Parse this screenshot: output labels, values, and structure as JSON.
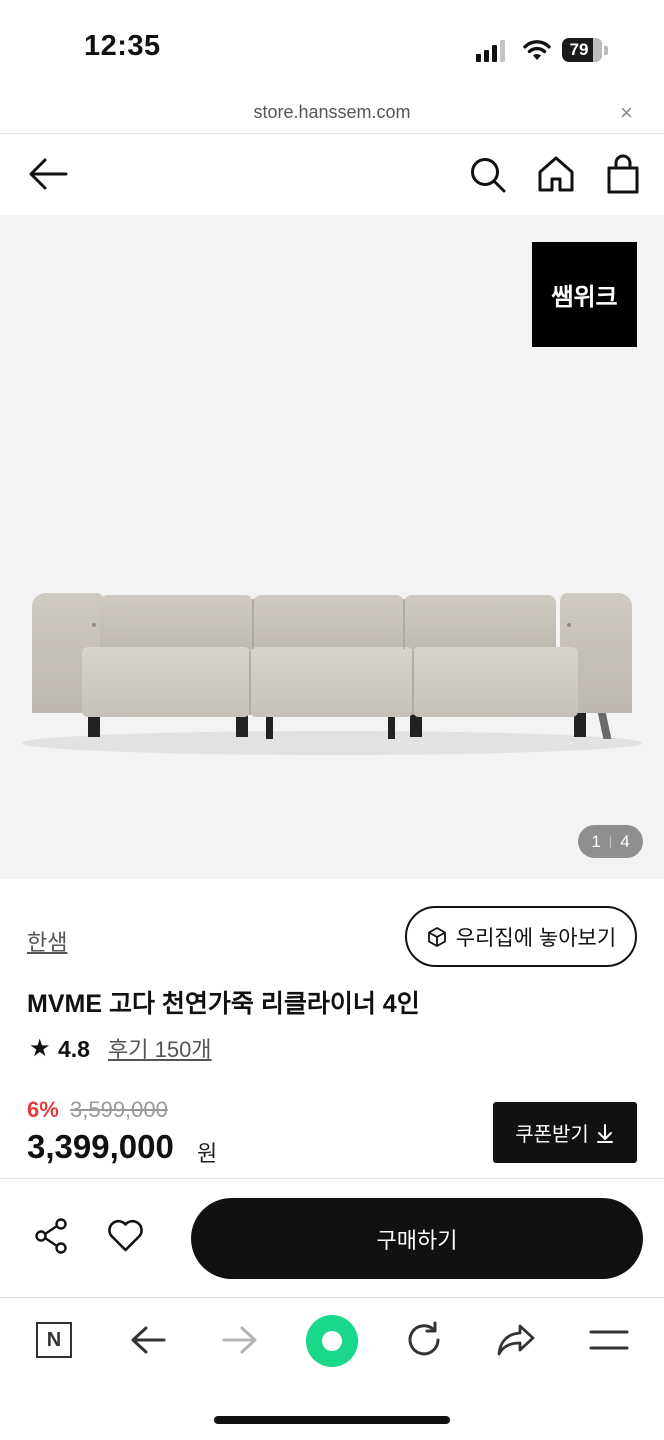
{
  "status_bar": {
    "time": "12:35",
    "battery": "79"
  },
  "browser": {
    "url": "store.hanssem.com",
    "close_label": "×"
  },
  "gallery": {
    "badge": "쌤위크",
    "current": "1",
    "total": "4"
  },
  "product": {
    "brand": "한샘",
    "ar_button": "우리집에 놓아보기",
    "title": "MVME 고다 천연가죽 리클라이너 4인",
    "rating": "4.8",
    "reviews": "후기 150개",
    "discount": "6%",
    "original_price": "3,599,000",
    "price": "3,399,000",
    "currency": "원",
    "coupon_button": "쿠폰받기"
  },
  "purchase_bar": {
    "buy_button": "구매하기"
  },
  "bottom_toolbar": {
    "n_label": "N"
  },
  "colors": {
    "accent_red": "#e43c3c",
    "green_button": "#19d889",
    "dark": "#111111"
  }
}
